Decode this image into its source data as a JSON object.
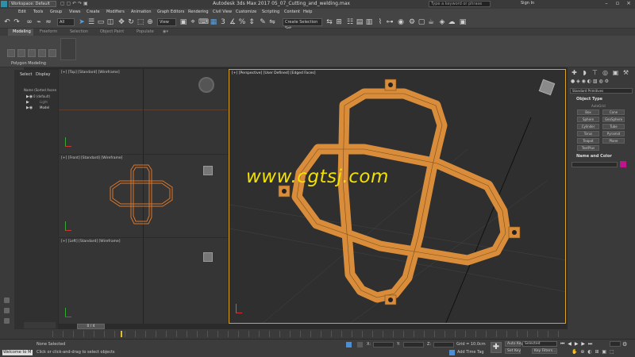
{
  "titlebar": {
    "workspace": "Workspace: Default",
    "app_title": "Autodesk 3ds Max 2017    05_07_Cutting_and_welding.max",
    "search_placeholder": "Type a keyword or phrase",
    "sign_in": "Sign In"
  },
  "menu": [
    "Edit",
    "Tools",
    "Group",
    "Views",
    "Create",
    "Modifiers",
    "Animation",
    "Graph Editors",
    "Rendering",
    "Civil View",
    "Customize",
    "Scripting",
    "Content",
    "Help"
  ],
  "toolbar": {
    "selection_filter": "All",
    "view_dropdown": "View",
    "named_selection": "Create Selection Set"
  },
  "ribbon": {
    "tabs": [
      "Modeling",
      "Freeform",
      "Selection",
      "Object Paint",
      "Populate"
    ],
    "group_label": "Polygon Modeling"
  },
  "scene_explorer": {
    "tabs": [
      "Select",
      "Display"
    ],
    "column": "Name (Sorted Ascen",
    "items": [
      "0 (default)",
      "Light",
      "Model"
    ]
  },
  "viewports": {
    "top": "[+] [Top] [Standard] [Wireframe]",
    "front": "[+] [Front] [Standard] [Wireframe]",
    "left": "[+] [Left] [Standard] [Wireframe]",
    "perspective": "[+] [Perspective] [User Defined] [Edged Faces]"
  },
  "watermark": "www.cgtsj.com",
  "command_panel": {
    "dropdown": "Standard Primitives",
    "object_type_title": "Object Type",
    "autogrid": "AutoGrid",
    "buttons": [
      "Box",
      "Cone",
      "Sphere",
      "GeoSphere",
      "Cylinder",
      "Tube",
      "Torus",
      "Pyramid",
      "Teapot",
      "Plane",
      "TextPlus"
    ],
    "name_color_title": "Name and Color"
  },
  "timeline": {
    "frame": "0 / 4"
  },
  "status": {
    "maxscript": "Welcome to M",
    "selection": "None Selected",
    "prompt": "Click or click-and-drag to select objects",
    "x_label": "X:",
    "y_label": "Y:",
    "z_label": "Z:",
    "grid": "Grid = 10.0cm",
    "add_time_tag": "Add Time Tag",
    "auto_key": "Auto Key",
    "set_key": "Set Key",
    "key_mode": "Selected",
    "key_filters": "Key Filters..."
  },
  "colors": {
    "accent_viewport_border": "#d9a323",
    "model_orange": "#d98d3a",
    "watermark": "#f2e000"
  }
}
